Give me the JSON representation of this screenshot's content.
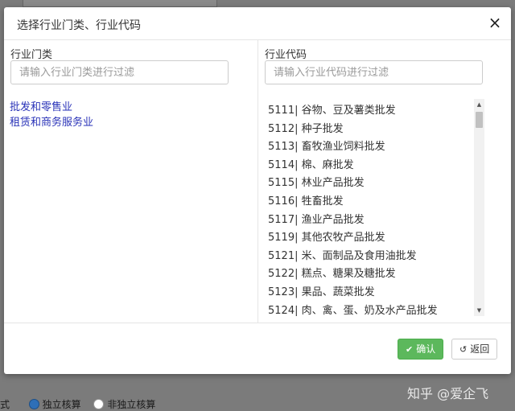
{
  "background": {
    "bottom_label": "式",
    "radio_option_1": "独立核算",
    "radio_option_2": "非独立核算"
  },
  "modal": {
    "title": "选择行业门类、行业代码",
    "close_glyph": "×",
    "left_panel": {
      "label": "行业门类",
      "filter_placeholder": "请输入行业门类进行过滤",
      "categories": [
        "批发和零售业",
        "租赁和商务服务业"
      ]
    },
    "right_panel": {
      "label": "行业代码",
      "filter_placeholder": "请输入行业代码进行过滤",
      "codes": [
        "5111| 谷物、豆及薯类批发",
        "5112| 种子批发",
        "5113| 畜牧渔业饲料批发",
        "5114| 棉、麻批发",
        "5115| 林业产品批发",
        "5116| 牲畜批发",
        "5117| 渔业产品批发",
        "5119| 其他农牧产品批发",
        "5121| 米、面制品及食用油批发",
        "5122| 糕点、糖果及糖批发",
        "5123| 果品、蔬菜批发",
        "5124| 肉、禽、蛋、奶及水产品批发"
      ]
    },
    "footer": {
      "confirm_label": "确认",
      "confirm_icon": "check-icon",
      "back_label": "返回",
      "back_icon": "undo-icon"
    }
  },
  "watermark": "知乎 @爱企飞",
  "colors": {
    "confirm_green": "#5cb85c",
    "link_blue": "#2a33b8",
    "overlay": "#6f6f6f"
  }
}
